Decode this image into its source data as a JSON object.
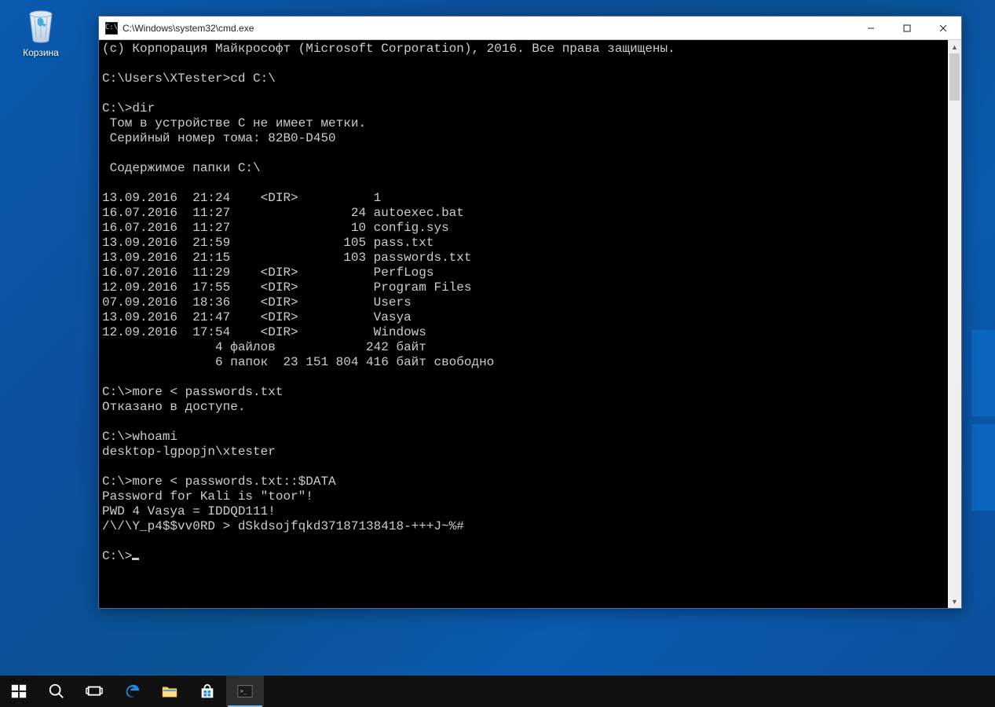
{
  "desktop": {
    "recycle_bin_label": "Корзина"
  },
  "window": {
    "title": "C:\\Windows\\system32\\cmd.exe"
  },
  "console": {
    "lines": [
      "(c) Корпорация Майкрософт (Microsoft Corporation), 2016. Все права защищены.",
      "",
      "C:\\Users\\XTester>cd C:\\",
      "",
      "C:\\>dir",
      " Том в устройстве C не имеет метки.",
      " Серийный номер тома: 82B0-D450",
      "",
      " Содержимое папки C:\\",
      "",
      "13.09.2016  21:24    <DIR>          1",
      "16.07.2016  11:27                24 autoexec.bat",
      "16.07.2016  11:27                10 config.sys",
      "13.09.2016  21:59               105 pass.txt",
      "13.09.2016  21:15               103 passwords.txt",
      "16.07.2016  11:29    <DIR>          PerfLogs",
      "12.09.2016  17:55    <DIR>          Program Files",
      "07.09.2016  18:36    <DIR>          Users",
      "13.09.2016  21:47    <DIR>          Vasya",
      "12.09.2016  17:54    <DIR>          Windows",
      "               4 файлов            242 байт",
      "               6 папок  23 151 804 416 байт свободно",
      "",
      "C:\\>more < passwords.txt",
      "Отказано в доступе.",
      "",
      "C:\\>whoami",
      "desktop-lgpopjn\\xtester",
      "",
      "C:\\>more < passwords.txt::$DATA",
      "Password for Kali is \"toor\"!",
      "PWD 4 Vasya = IDDQD111!",
      "/\\/\\Y_p4$$vv0RD > dSkdsojfqkd37187138418-+++J~%#",
      "",
      "C:\\>"
    ],
    "prompt_cursor": true
  },
  "taskbar": {
    "items": [
      {
        "name": "start",
        "icon": "windows-logo-icon"
      },
      {
        "name": "search",
        "icon": "search-icon"
      },
      {
        "name": "taskview",
        "icon": "task-view-icon"
      },
      {
        "name": "edge",
        "icon": "edge-icon"
      },
      {
        "name": "explorer",
        "icon": "file-explorer-icon"
      },
      {
        "name": "store",
        "icon": "store-icon"
      },
      {
        "name": "cmd",
        "icon": "cmd-icon"
      }
    ],
    "active": "cmd"
  }
}
